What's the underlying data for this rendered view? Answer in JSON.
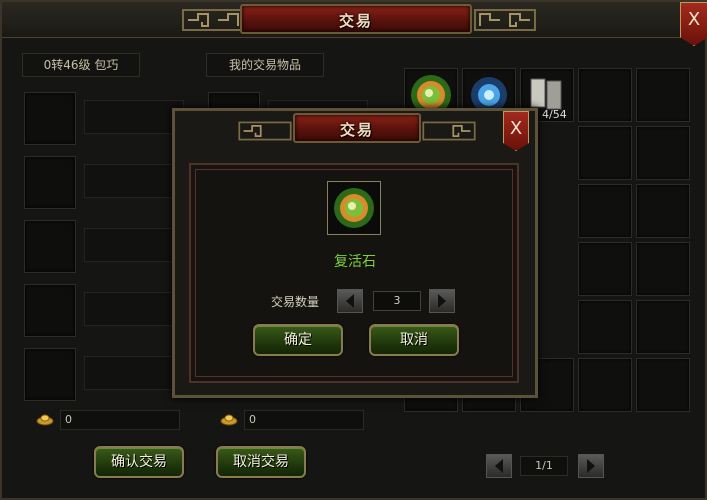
{
  "window": {
    "title": "交易",
    "close_label": "X"
  },
  "left_panel": {
    "partner_name": "0转46级 包巧",
    "partner_money": "0",
    "my_items_label": "我的交易物品",
    "my_money": "0"
  },
  "inventory": {
    "count_text": "4/54",
    "page_text": "1/1"
  },
  "buttons": {
    "confirm_trade": "确认交易",
    "cancel_trade": "取消交易"
  },
  "dialog": {
    "title": "交易",
    "close_label": "X",
    "item_name": "复活石",
    "quantity_label": "交易数量",
    "quantity_value": "3",
    "ok_label": "确定",
    "cancel_label": "取消"
  },
  "colors": {
    "accent_red": "#8a2218",
    "item_green": "#7fd03a",
    "button_green": "#2a4a12"
  },
  "icons": [
    "resurrection-stone-icon",
    "blue-orb-icon",
    "scroll-icon",
    "gold-ingot-icon"
  ]
}
